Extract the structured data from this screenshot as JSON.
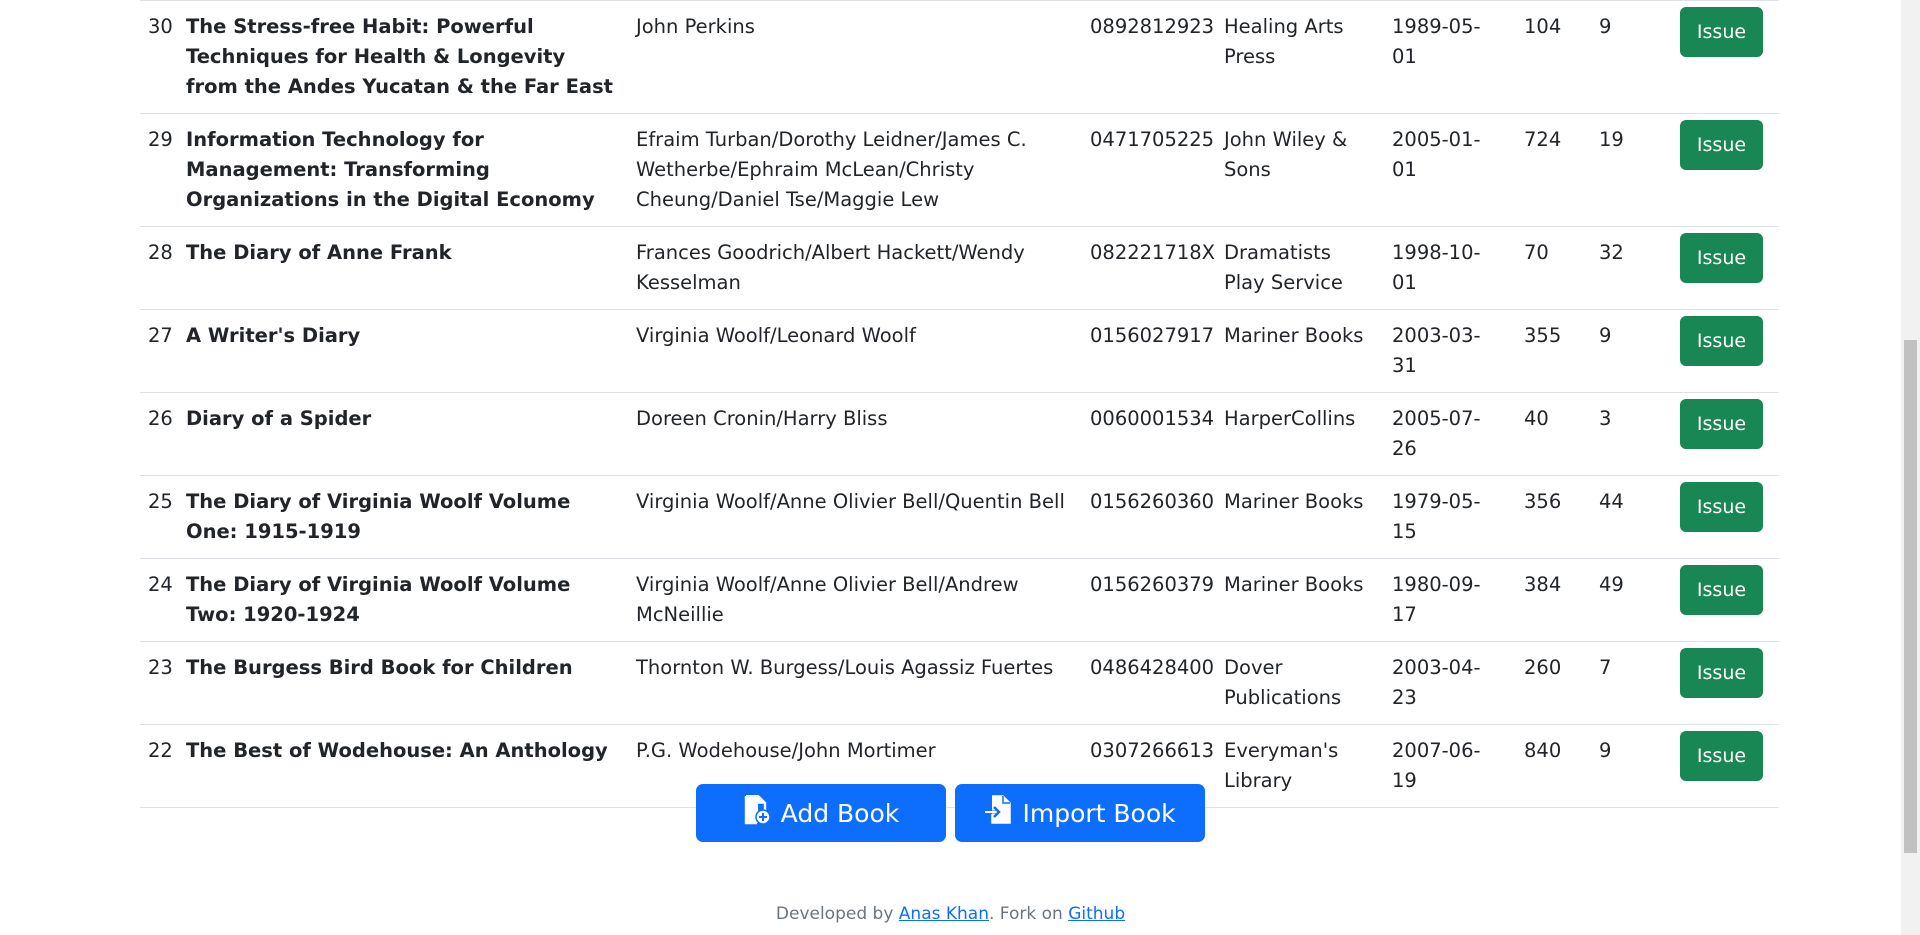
{
  "books": [
    {
      "id": "30",
      "title": "The Stress-free Habit: Powerful Techniques for Health & Longevity from the Andes Yucatan & the Far East",
      "author": "John Perkins",
      "isbn": "0892812923",
      "publisher": "Healing Arts Press",
      "date": "1989-05-01",
      "pages": "104",
      "qty": "9"
    },
    {
      "id": "29",
      "title": "Information Technology for Management: Transforming Organizations in the Digital Economy",
      "author": "Efraim Turban/Dorothy Leidner/James C. Wetherbe/Ephraim McLean/Christy Cheung/Daniel Tse/Maggie Lew",
      "isbn": "0471705225",
      "publisher": "John Wiley & Sons",
      "date": "2005-01-01",
      "pages": "724",
      "qty": "19"
    },
    {
      "id": "28",
      "title": "The Diary of Anne Frank",
      "author": "Frances Goodrich/Albert Hackett/Wendy Kesselman",
      "isbn": "082221718X",
      "publisher": "Dramatists Play Service",
      "date": "1998-10-01",
      "pages": "70",
      "qty": "32"
    },
    {
      "id": "27",
      "title": "A Writer's Diary",
      "author": "Virginia Woolf/Leonard Woolf",
      "isbn": "0156027917",
      "publisher": "Mariner Books",
      "date": "2003-03-31",
      "pages": "355",
      "qty": "9"
    },
    {
      "id": "26",
      "title": "Diary of a Spider",
      "author": "Doreen Cronin/Harry Bliss",
      "isbn": "0060001534",
      "publisher": "HarperCollins",
      "date": "2005-07-26",
      "pages": "40",
      "qty": "3"
    },
    {
      "id": "25",
      "title": "The Diary of Virginia Woolf Volume One: 1915-1919",
      "author": "Virginia Woolf/Anne Olivier Bell/Quentin Bell",
      "isbn": "0156260360",
      "publisher": "Mariner Books",
      "date": "1979-05-15",
      "pages": "356",
      "qty": "44"
    },
    {
      "id": "24",
      "title": "The Diary of Virginia Woolf Volume Two: 1920-1924",
      "author": "Virginia Woolf/Anne Olivier Bell/Andrew McNeillie",
      "isbn": "0156260379",
      "publisher": "Mariner Books",
      "date": "1980-09-17",
      "pages": "384",
      "qty": "49"
    },
    {
      "id": "23",
      "title": "The Burgess Bird Book for Children",
      "author": "Thornton W. Burgess/Louis Agassiz Fuertes",
      "isbn": "0486428400",
      "publisher": "Dover Publications",
      "date": "2003-04-23",
      "pages": "260",
      "qty": "7"
    },
    {
      "id": "22",
      "title": "The Best of Wodehouse: An Anthology",
      "author": "P.G. Wodehouse/John Mortimer",
      "isbn": "0307266613",
      "publisher": "Everyman's Library",
      "date": "2007-06-19",
      "pages": "840",
      "qty": "9"
    }
  ],
  "actions": {
    "issue_label": "Issue",
    "add_book_label": "Add Book",
    "import_book_label": "Import Book",
    "add_book_icon": "file-plus-icon",
    "import_book_icon": "file-import-icon"
  },
  "footer": {
    "prefix": "Developed by ",
    "author_link": "Anas Khan",
    "middle": ". Fork on ",
    "github_link": "Github"
  },
  "colors": {
    "issue_button": "#198754",
    "primary_button": "#0d6efd",
    "link": "#0d6efd"
  }
}
